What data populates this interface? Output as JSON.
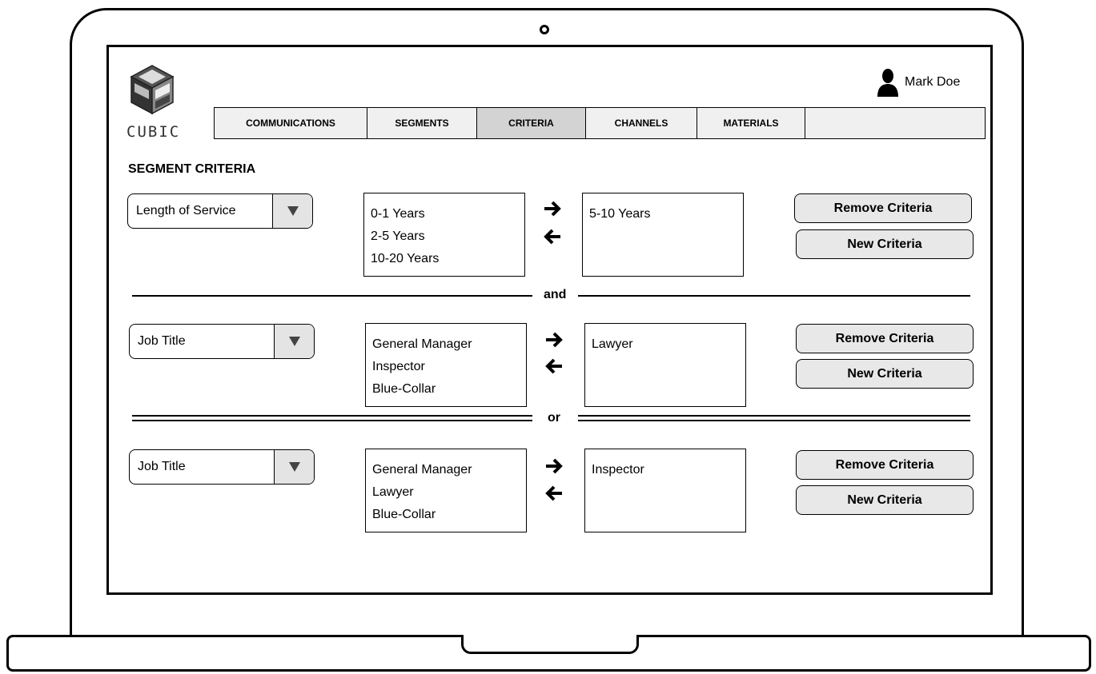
{
  "app": {
    "logo_text": "CUBIC"
  },
  "user": {
    "name": "Mark Doe"
  },
  "nav": {
    "tabs": [
      {
        "label": "COMMUNICATIONS",
        "active": false
      },
      {
        "label": "SEGMENTS",
        "active": false
      },
      {
        "label": "CRITERIA",
        "active": true
      },
      {
        "label": "CHANNELS",
        "active": false
      },
      {
        "label": "MATERIALS",
        "active": false
      }
    ]
  },
  "page": {
    "title": "SEGMENT CRITERIA"
  },
  "criteria": [
    {
      "field": "Length of Service",
      "available": [
        "0-1 Years",
        "2-5 Years",
        "10-20 Years"
      ],
      "selected": [
        "5-10 Years"
      ],
      "remove_label": "Remove Criteria",
      "new_label": "New Criteria"
    },
    {
      "field": "Job Title",
      "available": [
        "General Manager",
        "Inspector",
        "Blue-Collar"
      ],
      "selected": [
        "Lawyer"
      ],
      "remove_label": "Remove Criteria",
      "new_label": "New Criteria"
    },
    {
      "field": "Job Title",
      "available": [
        "General Manager",
        "Lawyer",
        "Blue-Collar"
      ],
      "selected": [
        "Inspector"
      ],
      "remove_label": "Remove Criteria",
      "new_label": "New Criteria"
    }
  ],
  "connectors": [
    "and",
    "or"
  ],
  "icons": {
    "logo": "cube-icon",
    "user": "user-icon",
    "dropdown": "triangle-down-icon",
    "move_right": "arrow-right-icon",
    "move_left": "arrow-left-icon"
  }
}
